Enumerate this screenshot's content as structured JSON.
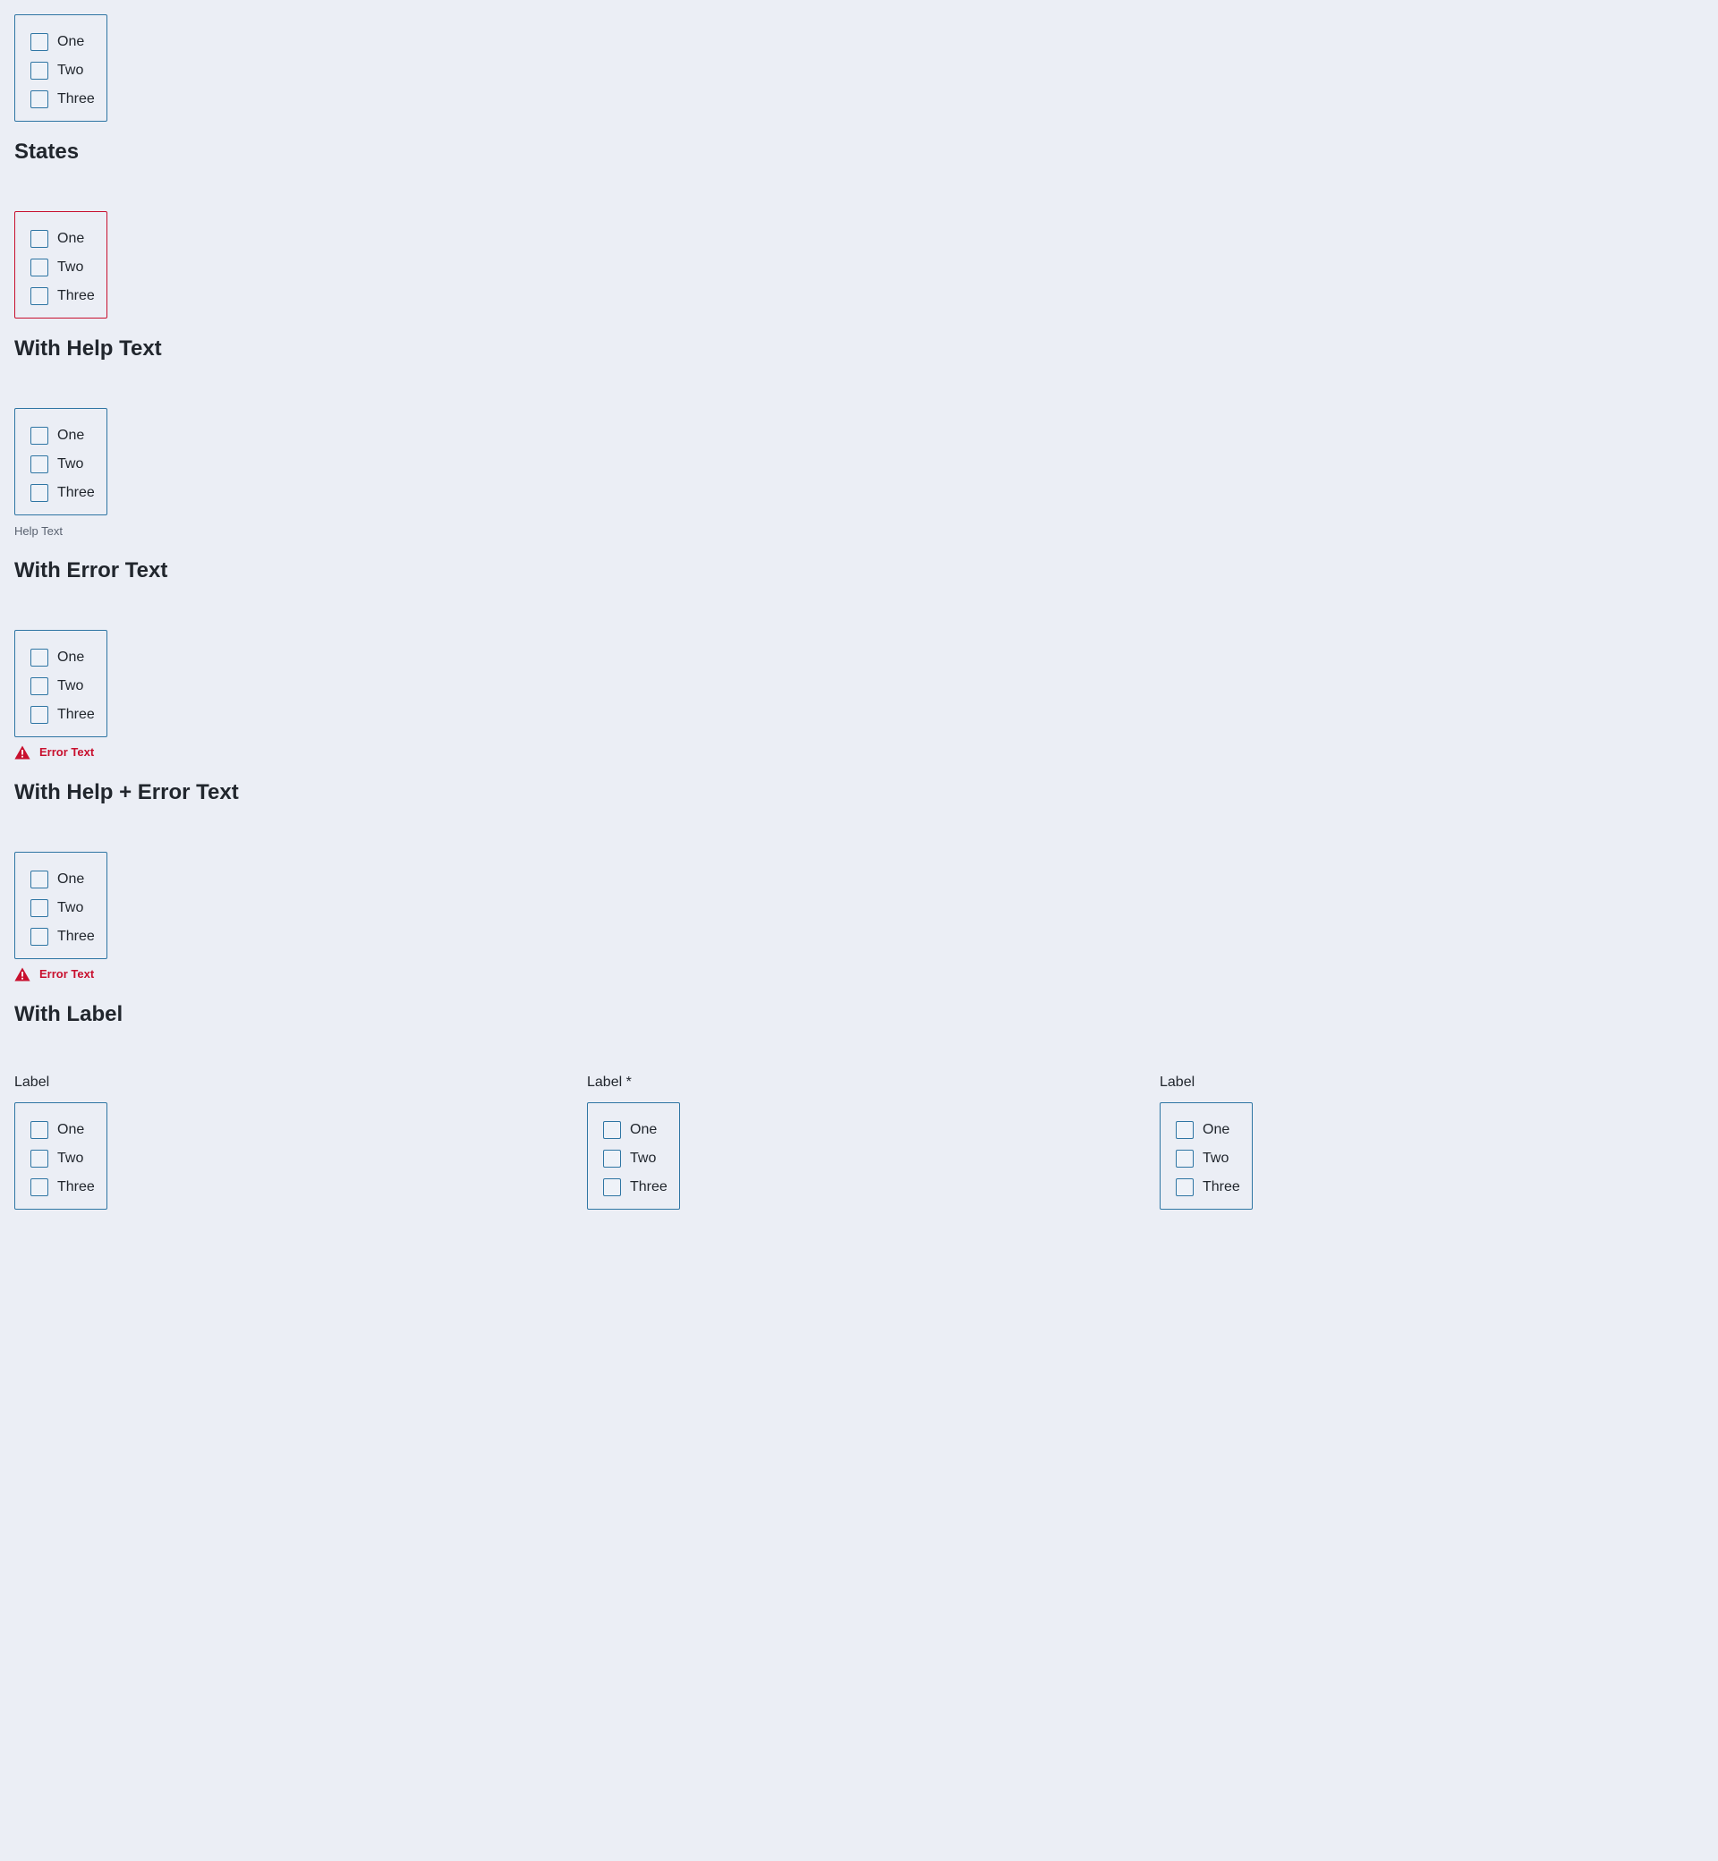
{
  "options": [
    "One",
    "Two",
    "Three"
  ],
  "sections": {
    "states": {
      "heading": "States"
    },
    "help_text": {
      "heading": "With Help Text",
      "help": "Help Text"
    },
    "error_text": {
      "heading": "With Error Text",
      "error": "Error Text"
    },
    "help_error_text": {
      "heading": "With Help + Error Text",
      "error": "Error Text"
    },
    "with_label": {
      "heading": "With Label",
      "labels": [
        "Label",
        "Label *",
        "Label"
      ]
    }
  },
  "colors": {
    "background": "#ebeef5",
    "border": "#2e75a3",
    "error": "#c8102e",
    "text": "#21262d",
    "help": "#5a6270"
  },
  "icons": {
    "error": "warning-triangle-icon"
  }
}
